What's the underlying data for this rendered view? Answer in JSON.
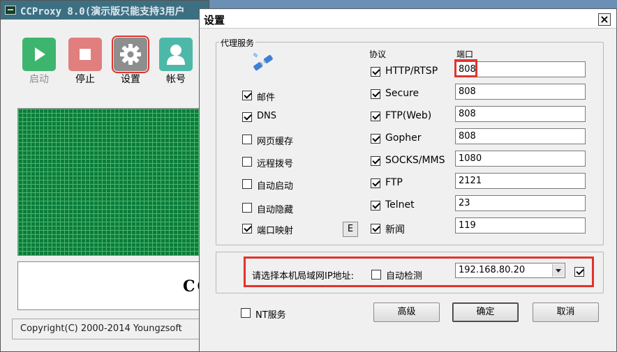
{
  "main_window": {
    "title": "CCProxy 8.0(演示版只能支持3用户",
    "toolbar": {
      "start": "启动",
      "stop": "停止",
      "settings": "设置",
      "account": "帐号"
    },
    "log_text": "CC",
    "copyright": "Copyright(C) 2000-2014 Youngzsoft"
  },
  "dialog": {
    "title": "设置",
    "close": "×",
    "group_proxy_services": "代理服务",
    "col_protocol": "协议",
    "col_port": "端口",
    "services": [
      {
        "label": "邮件",
        "checked": true
      },
      {
        "label": "DNS",
        "checked": true
      },
      {
        "label": "网页缓存",
        "checked": false
      },
      {
        "label": "远程拨号",
        "checked": false
      },
      {
        "label": "自动启动",
        "checked": false
      },
      {
        "label": "自动隐藏",
        "checked": false
      },
      {
        "label": "端口映射",
        "checked": true
      }
    ],
    "port_map_button": "E",
    "protocols": [
      {
        "label": "HTTP/RTSP",
        "checked": true,
        "port": "808"
      },
      {
        "label": "Secure",
        "checked": true,
        "port": "808"
      },
      {
        "label": "FTP(Web)",
        "checked": true,
        "port": "808"
      },
      {
        "label": "Gopher",
        "checked": true,
        "port": "808"
      },
      {
        "label": "SOCKS/MMS",
        "checked": true,
        "port": "1080"
      },
      {
        "label": "FTP",
        "checked": true,
        "port": "2121"
      },
      {
        "label": "Telnet",
        "checked": true,
        "port": "23"
      },
      {
        "label": "新闻",
        "checked": true,
        "port": "119"
      }
    ],
    "ip_label": "请选择本机局域网IP地址:",
    "auto_detect_label": "自动检测",
    "auto_detect_checked": false,
    "ip_value": "192.168.80.20",
    "ip_extra_checked": true,
    "nt_service_label": "NT服务",
    "nt_service_checked": false,
    "buttons": {
      "advanced": "高级",
      "ok": "确定",
      "cancel": "取消"
    }
  },
  "colors": {
    "highlight_red": "#e2332e",
    "monitor_green": "#0b7d3b",
    "start_green": "#3db56e",
    "stop_red": "#e07f7d",
    "account_teal": "#4db8a8"
  }
}
